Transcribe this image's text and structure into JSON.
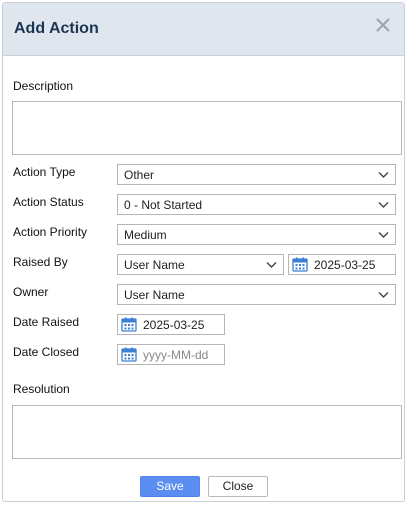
{
  "dialog": {
    "title": "Add Action"
  },
  "form": {
    "description_label": "Description",
    "description_value": "",
    "action_type_label": "Action Type",
    "action_type_value": "Other",
    "action_status_label": "Action Status",
    "action_status_value": "0 - Not Started",
    "action_priority_label": "Action Priority",
    "action_priority_value": "Medium",
    "raised_by_label": "Raised By",
    "raised_by_value": "User Name",
    "raised_by_date": "2025-03-25",
    "owner_label": "Owner",
    "owner_value": "User Name",
    "date_raised_label": "Date Raised",
    "date_raised_value": "2025-03-25",
    "date_closed_label": "Date Closed",
    "date_closed_placeholder": "yyyy-MM-dd",
    "resolution_label": "Resolution",
    "resolution_value": ""
  },
  "buttons": {
    "save": "Save",
    "close": "Close"
  },
  "icons": {
    "close": "close-icon",
    "dropdown": "chevron-down-icon",
    "calendar": "calendar-icon"
  },
  "colors": {
    "header_bg": "#dfe6ee",
    "title": "#1c3552",
    "save_button": "#5b8ef0",
    "calendar_icon": "#3b7fd4"
  }
}
